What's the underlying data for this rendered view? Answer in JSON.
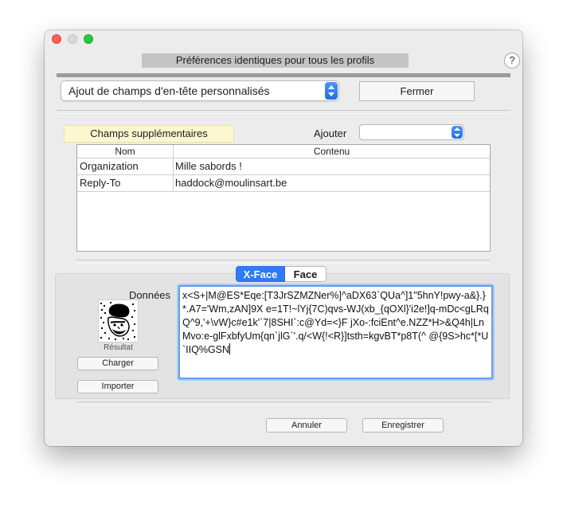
{
  "window": {
    "header_title": "Préférences identiques pour tous les profils",
    "help_label": "?"
  },
  "toolbar": {
    "section_select": "Ajout de champs d'en-tête personnalisés",
    "close_label": "Fermer"
  },
  "headers": {
    "extra_label": "Champs supplémentaires",
    "add_label": "Ajouter",
    "add_select_value": "",
    "columns": [
      "Nom",
      "Contenu"
    ],
    "rows": [
      {
        "name": "Organization",
        "value": "Mille sabords !"
      },
      {
        "name": "Reply-To",
        "value": "haddock@moulinsart.be"
      }
    ]
  },
  "xface": {
    "tabs": [
      "X-Face",
      "Face"
    ],
    "active_tab": "X-Face",
    "data_label": "Données",
    "data_value": "x<S+|M@ES*Eqe:[T3JrSZMZNer%]^aDX63`QUa^]1\"5hnY!pwy-a&}.}*.A7='Wm,zAN]9X e=1T!~lYj{7C)qvs-WJ(xb_{qOXl}'i2e!]q-mDc<gLRqQ^9,'+\\vW}c#e1k'`7|8SHI`:c@Yd=<}F jXo-:fciEnt^e.NZZ*H>&Q4h|LnMvo:e-glFxbfyUm{qn`jlG`'.q/<W{!<R}]tsth=kgvBT*p8T(^ @{9S>hc*[*U`IIQ%GSN",
    "result_label": "Résultat",
    "load_label": "Charger",
    "import_label": "Importer"
  },
  "footer": {
    "cancel_label": "Annuler",
    "save_label": "Enregistrer"
  },
  "colors": {
    "accent": "#2e7cf5",
    "note_bg": "#fdf7cf",
    "close": "#fe5f57",
    "zoom": "#28c840"
  }
}
